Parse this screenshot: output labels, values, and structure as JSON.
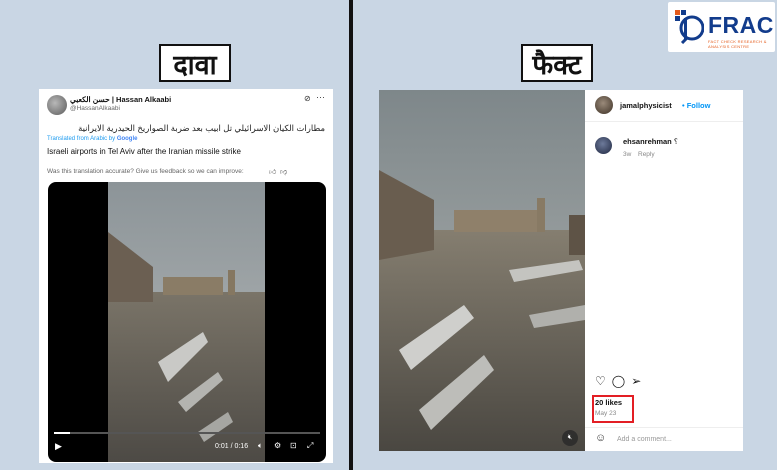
{
  "labels": {
    "claim": "दावा",
    "fact": "फैक्ट"
  },
  "logo": {
    "text": "FRAC",
    "subtext": "FACT CHECK RESEARCH & ANALYSIS CENTRE",
    "colors": {
      "blue": "#123c8c",
      "orange": "#e45b1b"
    }
  },
  "tweet": {
    "name": "حسن الكعبي | Hassan Alkaabi",
    "handle": "@HassanAlkaabi",
    "arabic_text": "مطارات الكيان الاسرائيلي تل ابيب بعد ضربة الصواريخ الحيدرية الايرانية",
    "translated_prefix": "Translated from Arabic by",
    "translator": "Google",
    "english_text": "Israeli airports in Tel Aviv after the Iranian missile strike",
    "feedback": "Was this translation accurate? Give us feedback so we can improve:",
    "video": {
      "time": "0:01 / 0:16",
      "progress": 0.06
    }
  },
  "instagram": {
    "username": "jamalphysicist",
    "follow": "• Follow",
    "comment": {
      "user": "ehsanrehman",
      "text": "؟",
      "time": "3w",
      "reply": "Reply"
    },
    "likes": "20 likes",
    "date": "May 23",
    "add_comment": "Add a comment..."
  },
  "icons": [
    "grok-icon",
    "more-icon",
    "thumbs-up-icon",
    "thumbs-down-icon",
    "play-icon",
    "volume-icon",
    "settings-icon",
    "pip-icon",
    "fullscreen-icon",
    "heart-icon",
    "comment-icon",
    "share-icon",
    "smiley-icon",
    "mute-icon"
  ],
  "colors": {
    "highlight": "#e31e24",
    "follow": "#0095f6",
    "link": "#1d9bf0"
  }
}
